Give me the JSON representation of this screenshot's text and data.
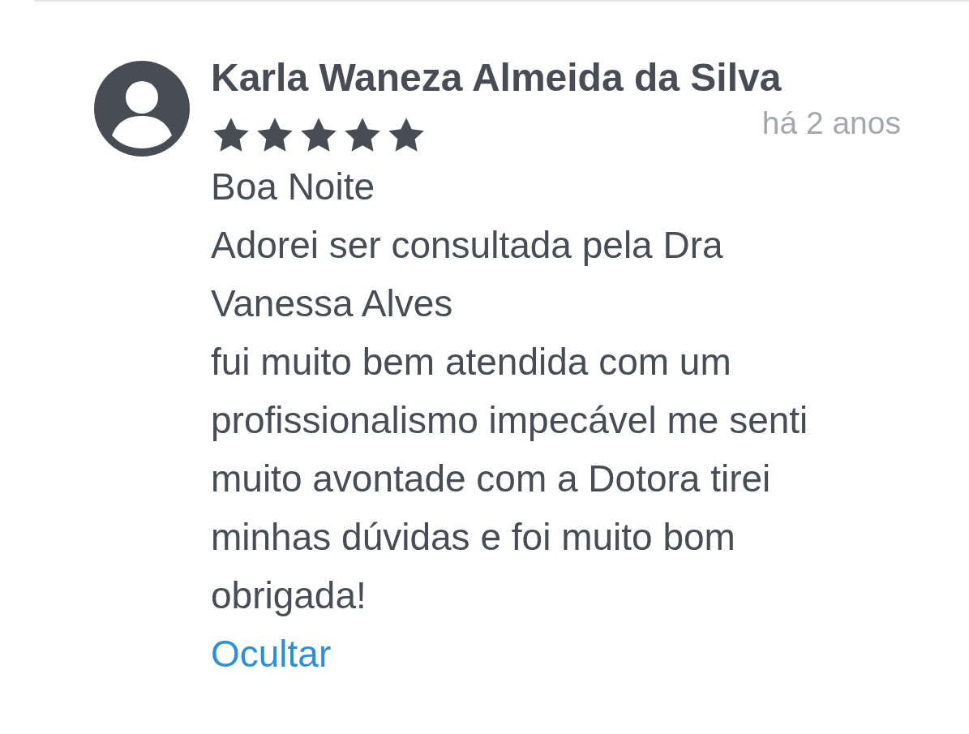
{
  "review": {
    "author": "Karla Waneza Almeida da Silva",
    "stars": 5,
    "time": "há 2 anos",
    "paragraphs": [
      "Boa Noite",
      "Adorei ser consultada pela Dra Vanessa Alves",
      "fui muito bem atendida com um profissionalismo impecável me senti muito avontade com a Dotora tirei minhas dúvidas e foi muito bom obrigada!"
    ],
    "hide_link": "Ocultar"
  }
}
